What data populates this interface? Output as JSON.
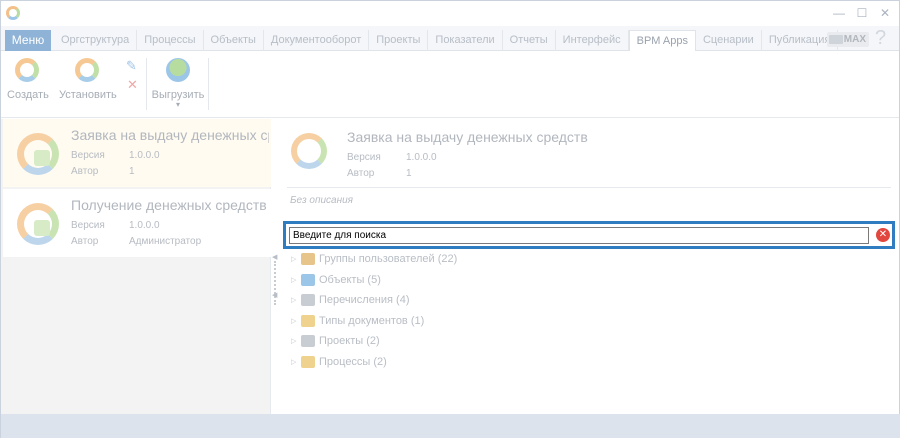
{
  "titlebar": {
    "minimize": "—",
    "maximize": "☐",
    "close": "✕"
  },
  "menu": {
    "label": "Меню"
  },
  "tabs": [
    {
      "label": "Оргструктура"
    },
    {
      "label": "Процессы"
    },
    {
      "label": "Объекты"
    },
    {
      "label": "Документооборот"
    },
    {
      "label": "Проекты"
    },
    {
      "label": "Показатели"
    },
    {
      "label": "Отчеты"
    },
    {
      "label": "Интерфейс"
    },
    {
      "label": "BPM Apps",
      "active": true
    },
    {
      "label": "Сценарии"
    },
    {
      "label": "Публикация"
    }
  ],
  "badge": {
    "label": "MAX"
  },
  "help": {
    "label": "?"
  },
  "ribbon": {
    "create": "Создать",
    "install": "Установить",
    "export": "Выгрузить",
    "export_arrow": "▾",
    "edit_icon": "✎",
    "delete_icon": "✕"
  },
  "apps": [
    {
      "title": "Заявка на выдачу денежных средств",
      "version_label": "Версия",
      "version": "1.0.0.0",
      "author_label": "Автор",
      "author": "1"
    },
    {
      "title": "Получение денежных средств",
      "version_label": "Версия",
      "version": "1.0.0.0",
      "author_label": "Автор",
      "author": "Администратор"
    }
  ],
  "detail": {
    "title": "Заявка на выдачу денежных средств",
    "version_label": "Версия",
    "version": "1.0.0.0",
    "author_label": "Автор",
    "author": "1",
    "description": "Без описания"
  },
  "search": {
    "placeholder": "Введите для поиска",
    "clear_icon": "✕"
  },
  "tree": [
    {
      "label": "Группы пользователей (22)",
      "icon": "users-icon",
      "color": "#e6c48a"
    },
    {
      "label": "Объекты (5)",
      "icon": "object-icon",
      "color": "#9cc6e8"
    },
    {
      "label": "Перечисления (4)",
      "icon": "enum-icon",
      "color": "#c8cdd3"
    },
    {
      "label": "Типы документов (1)",
      "icon": "folder-icon",
      "color": "#f0d28f"
    },
    {
      "label": "Проекты (2)",
      "icon": "project-icon",
      "color": "#c8cdd3"
    },
    {
      "label": "Процессы (2)",
      "icon": "folder-icon",
      "color": "#f0d28f"
    }
  ],
  "colors": {
    "accent": "#2f7cc1",
    "menu": "#8fb3d6",
    "clear": "#e2473f"
  }
}
